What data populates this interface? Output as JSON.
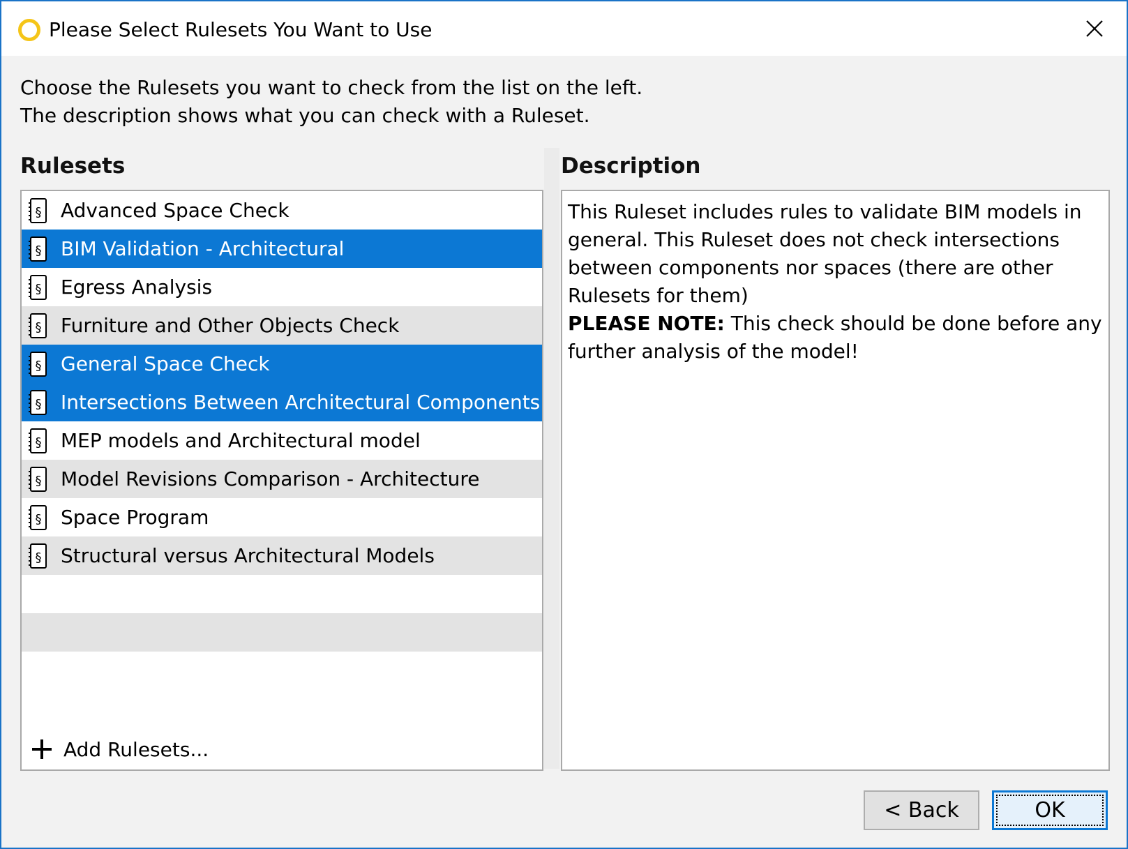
{
  "window": {
    "title": "Please Select Rulesets You Want to Use",
    "accent_color": "#0c78d4",
    "app_icon": "yellow-ring-icon",
    "close_icon": "close-icon"
  },
  "instructions": {
    "line1": "Choose the Rulesets you want to check from the list on the left.",
    "line2": "The description shows what you can check with a Ruleset."
  },
  "rulesets": {
    "heading": "Rulesets",
    "item_icon": "ruleset-document-icon",
    "items": [
      {
        "label": "Advanced Space Check",
        "selected": false
      },
      {
        "label": "BIM Validation - Architectural",
        "selected": true
      },
      {
        "label": "Egress Analysis",
        "selected": false
      },
      {
        "label": "Furniture and Other Objects Check",
        "selected": false
      },
      {
        "label": "General Space Check",
        "selected": true
      },
      {
        "label": "Intersections Between Architectural Components",
        "selected": true
      },
      {
        "label": "MEP models and Architectural model",
        "selected": false
      },
      {
        "label": "Model Revisions Comparison - Architecture",
        "selected": false
      },
      {
        "label": "Space Program",
        "selected": false
      },
      {
        "label": "Structural versus Architectural Models",
        "selected": false
      }
    ],
    "add_label": "Add Rulesets..."
  },
  "description": {
    "heading": "Description",
    "body": "This Ruleset includes rules to validate BIM models in general. This Ruleset does not check intersections between components nor spaces (there are other Rulesets for them)",
    "note_label": "PLEASE NOTE:",
    "note_text": " This check should be done before any further analysis of the model!"
  },
  "buttons": {
    "back": "< Back",
    "ok": "OK"
  }
}
